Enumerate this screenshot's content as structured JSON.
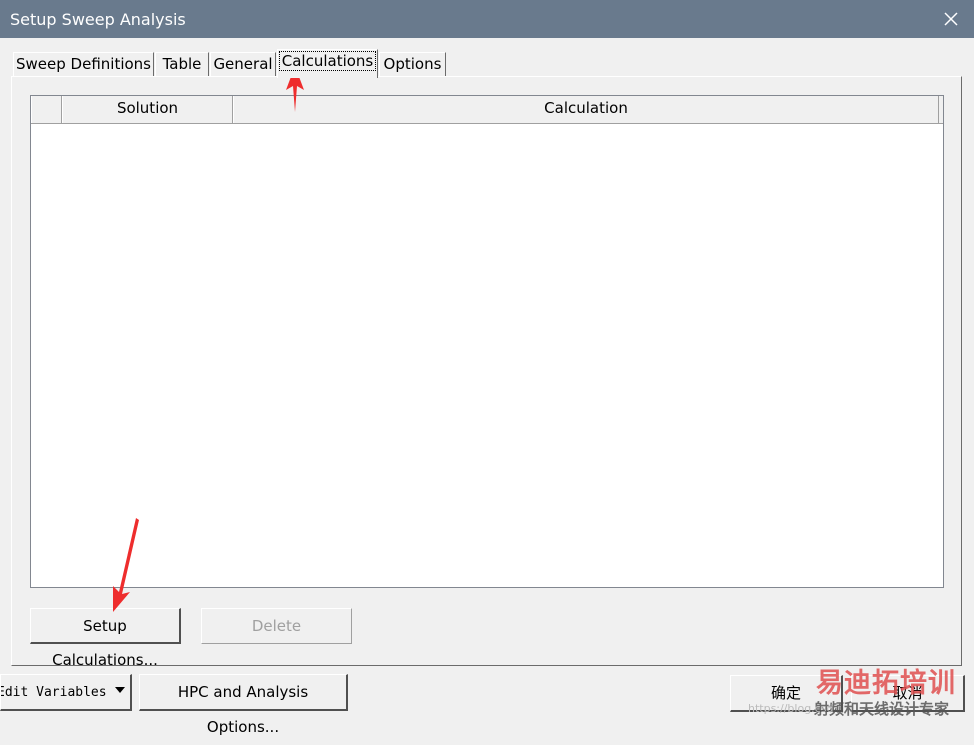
{
  "window": {
    "title": "Setup Sweep Analysis"
  },
  "tabs": [
    {
      "label": "Sweep Definitions",
      "active": false
    },
    {
      "label": "Table",
      "active": false
    },
    {
      "label": "General",
      "active": false
    },
    {
      "label": "Calculations",
      "active": true
    },
    {
      "label": "Options",
      "active": false
    }
  ],
  "grid": {
    "columns": [
      "",
      "Solution",
      "Calculation"
    ],
    "rows": []
  },
  "panel_buttons": {
    "setup": "Setup Calculations...",
    "delete": "Delete"
  },
  "footer": {
    "edit_variables": "Edit Variables",
    "hpc_options": "HPC and Analysis Options...",
    "ok": "确定",
    "cancel": "取消"
  },
  "watermark": {
    "logo": "易迪拓培训",
    "subtitle": "射频和天线设计专家",
    "url_fragment": "https://blog.csd"
  },
  "colors": {
    "titlebar": "#697a8d",
    "annotation_arrow": "#ee2d2d",
    "window_bg": "#f0f0f0"
  }
}
